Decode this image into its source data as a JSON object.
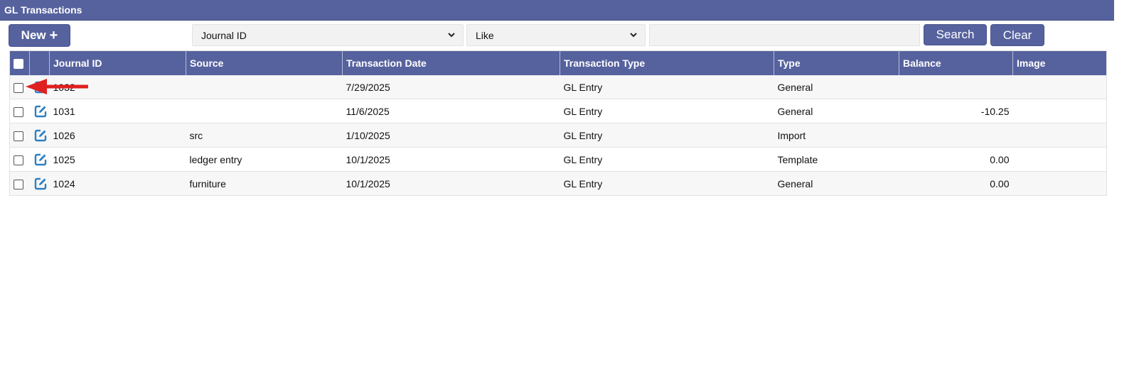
{
  "window": {
    "title": "GL Transactions"
  },
  "toolbar": {
    "new_label": "New",
    "new_plus": "+",
    "field_select": "Journal ID",
    "operator_select": "Like",
    "search_value": "",
    "search_label": "Search",
    "clear_label": "Clear"
  },
  "table": {
    "columns": [
      "Journal ID",
      "Source",
      "Transaction Date",
      "Transaction Type",
      "Type",
      "Balance",
      "Image"
    ],
    "rows": [
      {
        "journal_id": "1032",
        "source": "",
        "date": "7/29/2025",
        "transaction_type": "GL Entry",
        "type": "General",
        "balance": "",
        "image": ""
      },
      {
        "journal_id": "1031",
        "source": "",
        "date": "11/6/2025",
        "transaction_type": "GL Entry",
        "type": "General",
        "balance": "-10.25",
        "image": ""
      },
      {
        "journal_id": "1026",
        "source": "src",
        "date": "1/10/2025",
        "transaction_type": "GL Entry",
        "type": "Import",
        "balance": "",
        "image": ""
      },
      {
        "journal_id": "1025",
        "source": "ledger entry",
        "date": "10/1/2025",
        "transaction_type": "GL Entry",
        "type": "Template",
        "balance": "0.00",
        "image": ""
      },
      {
        "journal_id": "1024",
        "source": "furniture",
        "date": "10/1/2025",
        "transaction_type": "GL Entry",
        "type": "General",
        "balance": "0.00",
        "image": ""
      }
    ]
  },
  "colors": {
    "header": "#56629e",
    "edit_icon": "#2f7fc1",
    "arrow": "#e02020"
  },
  "icons": {
    "row_edit": "edit-icon",
    "annotation": "red-arrow-icon"
  }
}
